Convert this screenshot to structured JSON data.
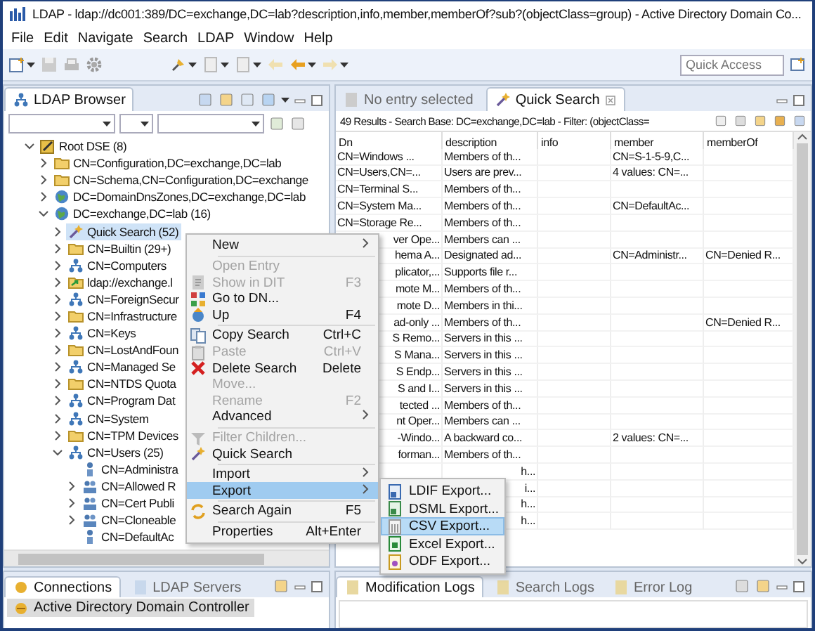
{
  "window": {
    "title": "LDAP - ldap://dc001:389/DC=exchange,DC=lab?description,info,member,memberOf?sub?(objectClass=group) - Active Directory Domain Co..."
  },
  "menu_bar": [
    "File",
    "Edit",
    "Navigate",
    "Search",
    "LDAP",
    "Window",
    "Help"
  ],
  "quick_access": {
    "placeholder": "Quick Access"
  },
  "browser": {
    "tab": "LDAP Browser",
    "tree": [
      {
        "label": "Root DSE (8)",
        "kind": "root",
        "expanded": true,
        "selected": false,
        "children": [
          {
            "label": "CN=Configuration,DC=exchange,DC=lab",
            "kind": "folder",
            "expanded": false,
            "selected": false
          },
          {
            "label": "CN=Schema,CN=Configuration,DC=exchange",
            "kind": "folder",
            "expanded": false,
            "selected": false
          },
          {
            "label": "DC=DomainDnsZones,DC=exchange,DC=lab",
            "kind": "domain",
            "expanded": false,
            "selected": false
          },
          {
            "label": "DC=exchange,DC=lab (16)",
            "kind": "domain",
            "expanded": true,
            "selected": false,
            "children": [
              {
                "label": "Quick Search (52)",
                "kind": "search",
                "expanded": false,
                "selected": true
              },
              {
                "label": "CN=Builtin (29+)",
                "kind": "folder",
                "expanded": false,
                "selected": false
              },
              {
                "label": "CN=Computers",
                "kind": "org",
                "expanded": false,
                "selected": false
              },
              {
                "label": "ldap://exchange.l",
                "kind": "link",
                "expanded": false,
                "selected": false
              },
              {
                "label": "CN=ForeignSecur",
                "kind": "org",
                "expanded": false,
                "selected": false
              },
              {
                "label": "CN=Infrastructure",
                "kind": "folder",
                "expanded": false,
                "selected": false
              },
              {
                "label": "CN=Keys",
                "kind": "org",
                "expanded": false,
                "selected": false
              },
              {
                "label": "CN=LostAndFoun",
                "kind": "folder",
                "expanded": false,
                "selected": false
              },
              {
                "label": "CN=Managed Se",
                "kind": "org",
                "expanded": false,
                "selected": false
              },
              {
                "label": "CN=NTDS Quota",
                "kind": "folder",
                "expanded": false,
                "selected": false
              },
              {
                "label": "CN=Program Dat",
                "kind": "org",
                "expanded": false,
                "selected": false
              },
              {
                "label": "CN=System",
                "kind": "org",
                "expanded": false,
                "selected": false
              },
              {
                "label": "CN=TPM Devices",
                "kind": "folder",
                "expanded": false,
                "selected": false
              },
              {
                "label": "CN=Users (25)",
                "kind": "org",
                "expanded": true,
                "selected": false,
                "children": [
                  {
                    "label": "CN=Administra",
                    "kind": "user",
                    "selected": false
                  },
                  {
                    "label": "CN=Allowed R",
                    "kind": "group",
                    "expanded": false,
                    "selected": false
                  },
                  {
                    "label": "CN=Cert Publi",
                    "kind": "group",
                    "expanded": false,
                    "selected": false
                  },
                  {
                    "label": "CN=Cloneable",
                    "kind": "group",
                    "expanded": false,
                    "selected": false
                  },
                  {
                    "label": "CN=DefaultAc",
                    "kind": "user",
                    "selected": false
                  }
                ]
              }
            ]
          }
        ]
      }
    ]
  },
  "editor_tabs": [
    {
      "label": "No entry selected",
      "selected": false
    },
    {
      "label": "Quick Search",
      "selected": true
    }
  ],
  "search_summary": "49 Results - Search Base: DC=exchange,DC=lab - Filter: (objectClass=",
  "table": {
    "columns": [
      "Dn",
      "description",
      "info",
      "member",
      "memberOf"
    ],
    "rows": [
      {
        "dn": "CN=Windows ...",
        "description": "Members of th...",
        "member": "CN=S-1-5-9,C...",
        "dn_covered": false,
        "description_covered": false
      },
      {
        "dn": "CN=Users,CN=...",
        "description": "Users are prev...",
        "member": "4 values: CN=...",
        "dn_covered": false,
        "description_covered": false
      },
      {
        "dn": "CN=Terminal S...",
        "description": "Members of th...",
        "dn_covered": false,
        "description_covered": false
      },
      {
        "dn": "CN=System Ma...",
        "description": "Members of th...",
        "member": "CN=DefaultAc...",
        "dn_covered": false,
        "description_covered": false
      },
      {
        "dn": "CN=Storage Re...",
        "description": "Members of th...",
        "dn_covered": false,
        "description_covered": false
      },
      {
        "dn": "ver Ope...",
        "description": "Members can ...",
        "dn_covered": true,
        "description_covered": false
      },
      {
        "dn": "hema A...",
        "description": "Designated ad...",
        "member": "CN=Administr...",
        "member_of": "CN=Denied R...",
        "dn_covered": true,
        "description_covered": false
      },
      {
        "dn": "plicator,...",
        "description": "Supports file r...",
        "dn_covered": true,
        "description_covered": false
      },
      {
        "dn": "mote M...",
        "description": "Members of th...",
        "dn_covered": true,
        "description_covered": false
      },
      {
        "dn": "mote D...",
        "description": "Members in thi...",
        "dn_covered": true,
        "description_covered": false
      },
      {
        "dn": "ad-only ...",
        "description": "Members of th...",
        "member_of": "CN=Denied R...",
        "dn_covered": true,
        "description_covered": false
      },
      {
        "dn": "S Remo...",
        "description": "Servers in this ...",
        "dn_covered": true,
        "description_covered": false
      },
      {
        "dn": "S Mana...",
        "description": "Servers in this ...",
        "dn_covered": true,
        "description_covered": false
      },
      {
        "dn": "S Endp...",
        "description": "Servers in this ...",
        "dn_covered": true,
        "description_covered": false
      },
      {
        "dn": "S and I...",
        "description": "Servers in this ...",
        "dn_covered": true,
        "description_covered": false
      },
      {
        "dn": "tected ...",
        "description": "Members of th...",
        "dn_covered": true,
        "description_covered": false
      },
      {
        "dn": "nt Oper...",
        "description": "Members can ...",
        "dn_covered": true,
        "description_covered": false
      },
      {
        "dn": "-Windo...",
        "description": "A backward co...",
        "member": "2 values: CN=...",
        "dn_covered": true,
        "description_covered": false
      },
      {
        "dn": "forman...",
        "description": "Members of th...",
        "dn_covered": true,
        "description_covered": false
      },
      {
        "description": "h...",
        "dn_covered": true,
        "description_covered": true
      },
      {
        "description": "i...",
        "dn_covered": true,
        "description_covered": true
      },
      {
        "description": "h...",
        "dn_covered": true,
        "description_covered": true
      },
      {
        "description": "h...",
        "dn_covered": true,
        "description_covered": true
      }
    ]
  },
  "context_menu": [
    {
      "kind": "item",
      "label": "New",
      "submenu_arrow": true,
      "disabled": false,
      "selected": false
    },
    {
      "kind": "separator"
    },
    {
      "kind": "item",
      "label": "Open Entry",
      "submenu_arrow": false,
      "disabled": true,
      "selected": false
    },
    {
      "kind": "item",
      "label": "Show in DIT",
      "shortcut": "F3",
      "submenu_arrow": false,
      "disabled": true,
      "selected": false
    },
    {
      "kind": "item",
      "label": "Go to DN...",
      "submenu_arrow": false,
      "disabled": false,
      "selected": false
    },
    {
      "kind": "item",
      "label": "Up",
      "shortcut": "F4",
      "submenu_arrow": false,
      "disabled": false,
      "selected": false
    },
    {
      "kind": "separator"
    },
    {
      "kind": "item",
      "label": "Copy Search",
      "shortcut": "Ctrl+C",
      "submenu_arrow": false,
      "disabled": false,
      "selected": false
    },
    {
      "kind": "item",
      "label": "Paste",
      "shortcut": "Ctrl+V",
      "submenu_arrow": false,
      "disabled": true,
      "selected": false
    },
    {
      "kind": "item",
      "label": "Delete Search",
      "shortcut": "Delete",
      "submenu_arrow": false,
      "disabled": false,
      "selected": false
    },
    {
      "kind": "item",
      "label": "Move...",
      "submenu_arrow": false,
      "disabled": true,
      "selected": false
    },
    {
      "kind": "item",
      "label": "Rename",
      "shortcut": "F2",
      "submenu_arrow": false,
      "disabled": true,
      "selected": false
    },
    {
      "kind": "item",
      "label": "Advanced",
      "submenu_arrow": true,
      "disabled": false,
      "selected": false
    },
    {
      "kind": "separator"
    },
    {
      "kind": "item",
      "label": "Filter Children...",
      "submenu_arrow": false,
      "disabled": true,
      "selected": false
    },
    {
      "kind": "item",
      "label": "Quick Search",
      "submenu_arrow": false,
      "disabled": false,
      "selected": false
    },
    {
      "kind": "separator"
    },
    {
      "kind": "item",
      "label": "Import",
      "submenu_arrow": true,
      "disabled": false,
      "selected": false
    },
    {
      "kind": "item",
      "label": "Export",
      "submenu_arrow": true,
      "disabled": false,
      "selected": true,
      "submenu": [
        {
          "label": "LDIF Export...",
          "selected": false
        },
        {
          "label": "DSML Export...",
          "selected": false
        },
        {
          "label": "CSV Export...",
          "selected": true
        },
        {
          "label": "Excel Export...",
          "selected": false
        },
        {
          "label": "ODF Export...",
          "selected": false
        }
      ]
    },
    {
      "kind": "separator"
    },
    {
      "kind": "item",
      "label": "Search Again",
      "shortcut": "F5",
      "submenu_arrow": false,
      "disabled": false,
      "selected": false
    },
    {
      "kind": "separator"
    },
    {
      "kind": "item",
      "label": "Properties",
      "shortcut": "Alt+Enter",
      "submenu_arrow": false,
      "disabled": false,
      "selected": false
    }
  ],
  "connections": {
    "tabs": [
      {
        "label": "Connections",
        "selected": true
      },
      {
        "label": "LDAP Servers",
        "selected": false
      }
    ],
    "items": [
      {
        "label": "Active Directory Domain Controller",
        "selected": true
      }
    ]
  },
  "logs": {
    "tabs": [
      {
        "label": "Modification Logs",
        "selected": true
      },
      {
        "label": "Search Logs",
        "selected": false
      },
      {
        "label": "Error Log",
        "selected": false
      }
    ]
  }
}
